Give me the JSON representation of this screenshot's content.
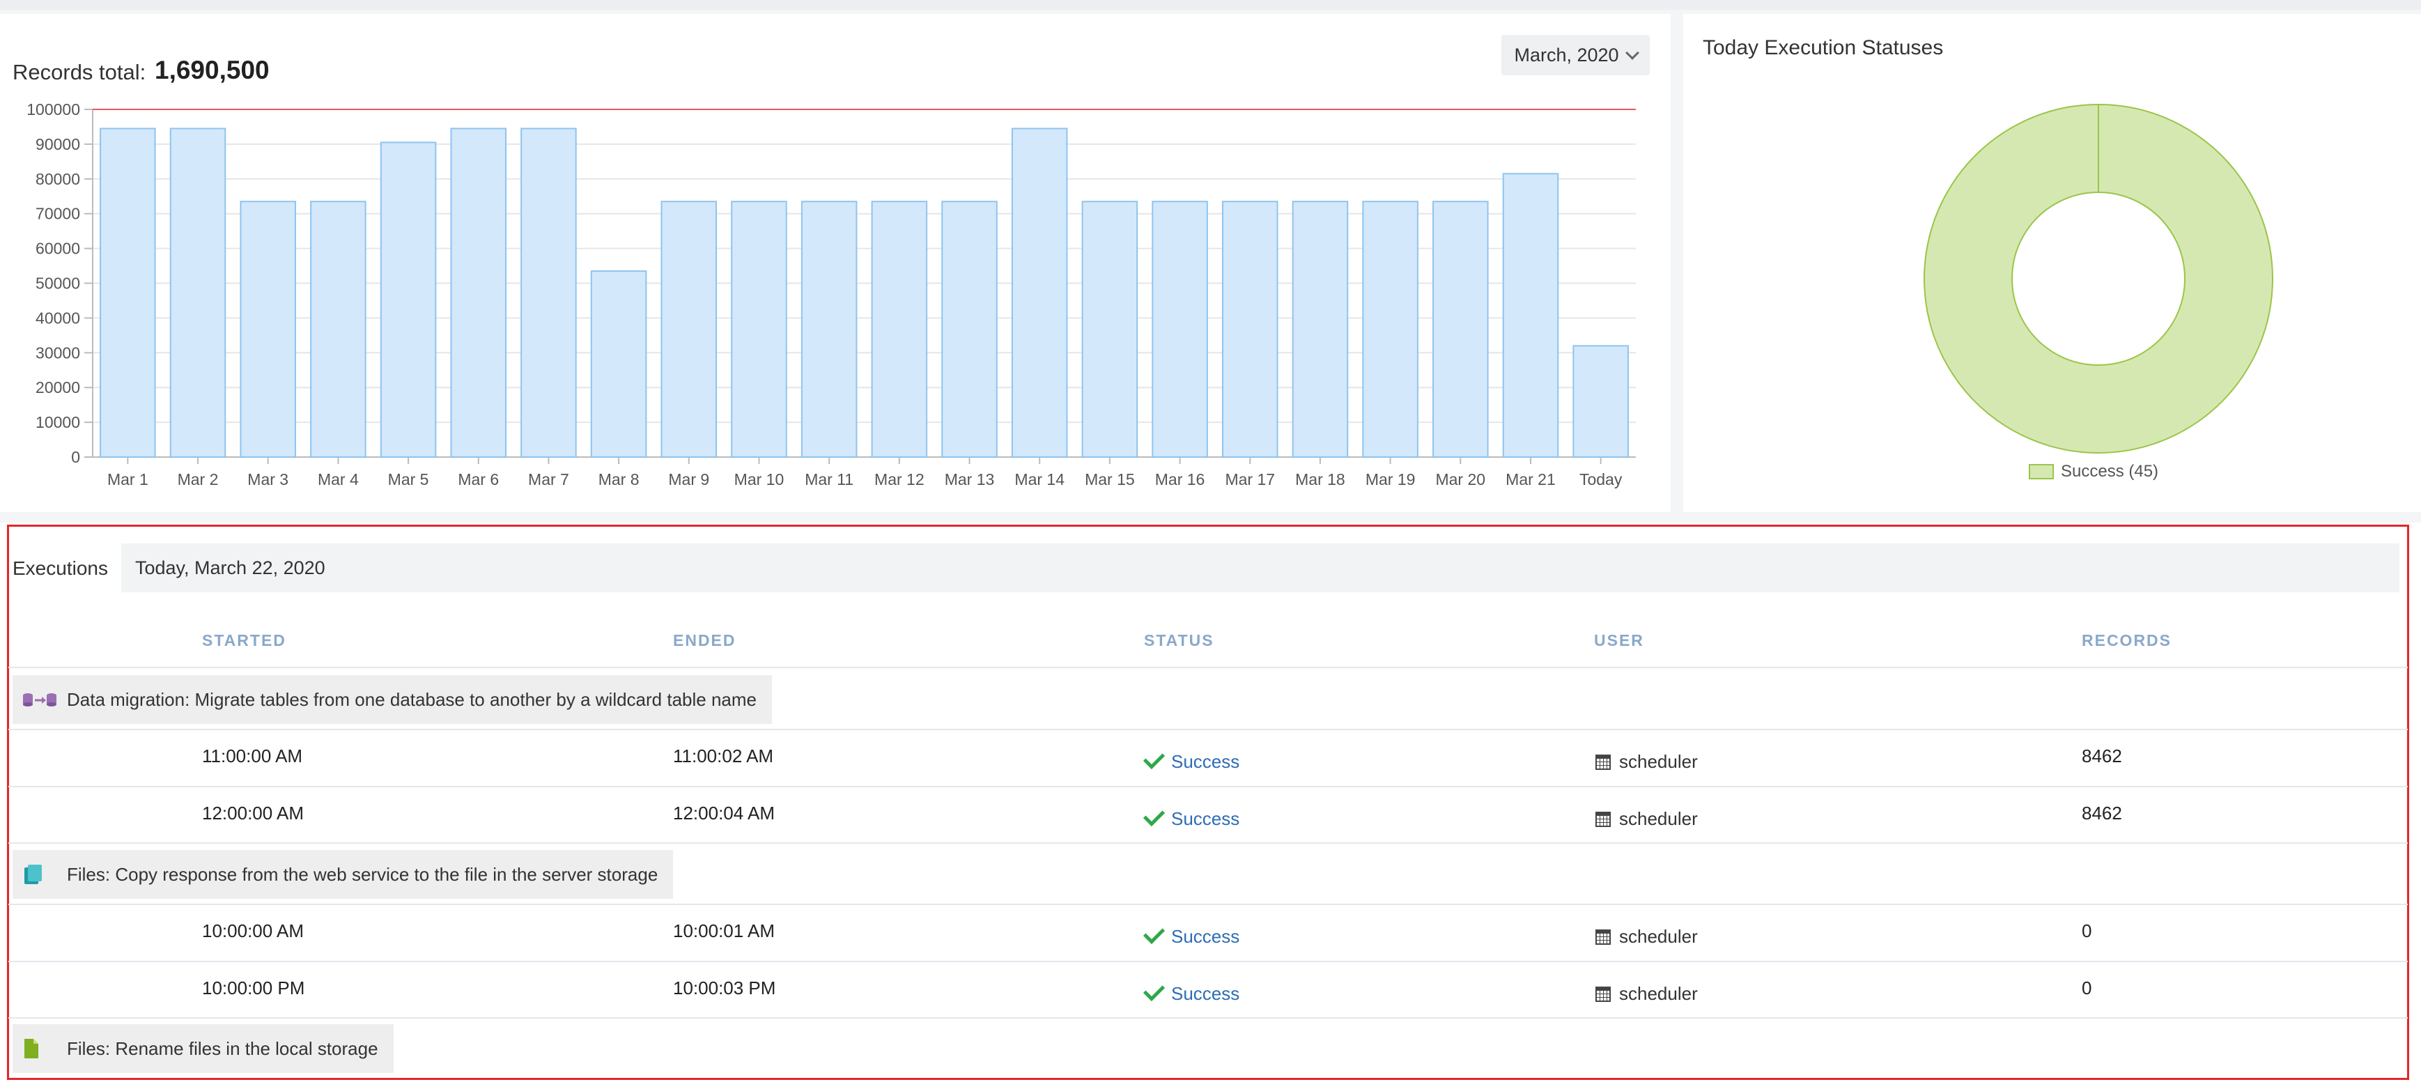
{
  "records": {
    "label": "Records total:",
    "total": "1,690,500",
    "month_selector": "March, 2020"
  },
  "chart_data": {
    "type": "bar",
    "categories": [
      "Mar 1",
      "Mar 2",
      "Mar 3",
      "Mar 4",
      "Mar 5",
      "Mar 6",
      "Mar 7",
      "Mar 8",
      "Mar 9",
      "Mar 10",
      "Mar 11",
      "Mar 12",
      "Mar 13",
      "Mar 14",
      "Mar 15",
      "Mar 16",
      "Mar 17",
      "Mar 18",
      "Mar 19",
      "Mar 20",
      "Mar 21",
      "Today"
    ],
    "values": [
      94500,
      94500,
      73500,
      73500,
      90500,
      94500,
      94500,
      53500,
      73500,
      73500,
      73500,
      73500,
      73500,
      94500,
      73500,
      73500,
      73500,
      73500,
      73500,
      73500,
      81500,
      32000
    ],
    "ylim": [
      0,
      100000
    ],
    "yticks": [
      0,
      10000,
      20000,
      30000,
      40000,
      50000,
      60000,
      70000,
      80000,
      90000,
      100000
    ],
    "limit_line": 100000,
    "grid": true,
    "bar_fill": "#d4e8fb",
    "bar_stroke": "#8ec4ef",
    "limit_color": "#e9585e"
  },
  "status_chart": {
    "title": "Today Execution Statuses",
    "type": "pie",
    "slices": [
      {
        "label": "Success (45)",
        "value": 45,
        "color": "#d6e8b2",
        "stroke": "#9ac548"
      }
    ]
  },
  "executions": {
    "label": "Executions",
    "date": "Today, March 22, 2020",
    "columns": [
      "STARTED",
      "ENDED",
      "STATUS",
      "USER",
      "RECORDS"
    ],
    "groups": [
      {
        "title": "Data migration: Migrate tables from one database to another by a wildcard table name",
        "icon": "database-migration-icon",
        "rows": [
          {
            "started": "11:00:00 AM",
            "ended": "11:00:02 AM",
            "status": "Success",
            "user": "scheduler",
            "records": "8462"
          },
          {
            "started": "12:00:00 AM",
            "ended": "12:00:04 AM",
            "status": "Success",
            "user": "scheduler",
            "records": "8462"
          }
        ]
      },
      {
        "title": "Files: Copy response from the web service to the file in the server storage",
        "icon": "file-copy-icon",
        "rows": [
          {
            "started": "10:00:00 AM",
            "ended": "10:00:01 AM",
            "status": "Success",
            "user": "scheduler",
            "records": "0"
          },
          {
            "started": "10:00:00 PM",
            "ended": "10:00:03 PM",
            "status": "Success",
            "user": "scheduler",
            "records": "0"
          }
        ]
      },
      {
        "title": "Files: Rename files in the local storage",
        "icon": "file-icon",
        "rows": []
      }
    ]
  }
}
